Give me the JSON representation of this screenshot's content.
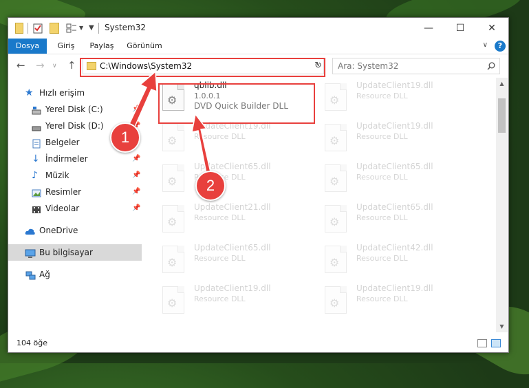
{
  "window": {
    "title": "System32",
    "controls": {
      "minimize": "—",
      "maximize": "☐",
      "close": "✕"
    }
  },
  "ribbon": {
    "tabs": [
      {
        "label": "Dosya"
      },
      {
        "label": "Giriş"
      },
      {
        "label": "Paylaş"
      },
      {
        "label": "Görünüm"
      }
    ],
    "help": "?",
    "accent": "#1979ca"
  },
  "nav": {
    "address": "C:\\Windows\\System32",
    "search_placeholder": "Ara: System32"
  },
  "sidebar": {
    "quick_access": "Hızlı erişim",
    "items": [
      {
        "label": "Yerel Disk (C:)",
        "icon": "drive-icon"
      },
      {
        "label": "Yerel Disk (D:)",
        "icon": "drive-icon"
      },
      {
        "label": "Belgeler",
        "icon": "documents-icon"
      },
      {
        "label": "İndirmeler",
        "icon": "download-icon"
      },
      {
        "label": "Müzik",
        "icon": "music-icon"
      },
      {
        "label": "Resimler",
        "icon": "pictures-icon"
      },
      {
        "label": "Videolar",
        "icon": "videos-icon"
      }
    ],
    "onedrive": "OneDrive",
    "this_pc": "Bu bilgisayar",
    "network": "Ağ"
  },
  "files": {
    "highlighted": {
      "name": "qblib.dll",
      "version": "1.0.0.1",
      "description": "DVD Quick Builder DLL"
    },
    "others": [
      {
        "name": "UpdateClient19.dll",
        "type": "Resource DLL"
      },
      {
        "name": "UpdateClient19.dll",
        "type": "Resource DLL"
      },
      {
        "name": "UpdateClient19.dll",
        "type": "Resource DLL"
      },
      {
        "name": "UpdateClient65.dll",
        "type": "Resource DLL"
      },
      {
        "name": "UpdateClient65.dll",
        "type": "Resource DLL"
      },
      {
        "name": "UpdateClient21.dll",
        "type": "Resource DLL"
      },
      {
        "name": "UpdateClient65.dll",
        "type": "Resource DLL"
      },
      {
        "name": "UpdateClient65.dll",
        "type": "Resource DLL"
      },
      {
        "name": "UpdateClient42.dll",
        "type": "Resource DLL"
      },
      {
        "name": "UpdateClient19.dll",
        "type": "Resource DLL"
      },
      {
        "name": "UpdateClient19.dll",
        "type": "Resource DLL"
      }
    ]
  },
  "status": {
    "count": "104 öğe"
  },
  "annotations": {
    "step1": "1",
    "step2": "2",
    "color": "#e8403d"
  }
}
